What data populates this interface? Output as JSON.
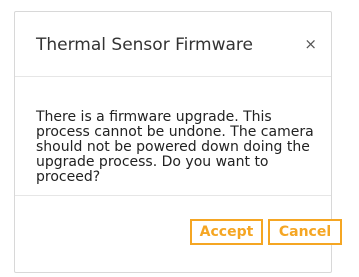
{
  "dialog": {
    "title": "Thermal Sensor Firmware",
    "close_symbol": "×",
    "message": "There is a firmware upgrade. This process cannot be undone. The camera should not be powered down doing the upgrade process. Do you want to proceed?",
    "accept_label": "Accept",
    "cancel_label": "Cancel",
    "accent_color": "#f5a623"
  }
}
